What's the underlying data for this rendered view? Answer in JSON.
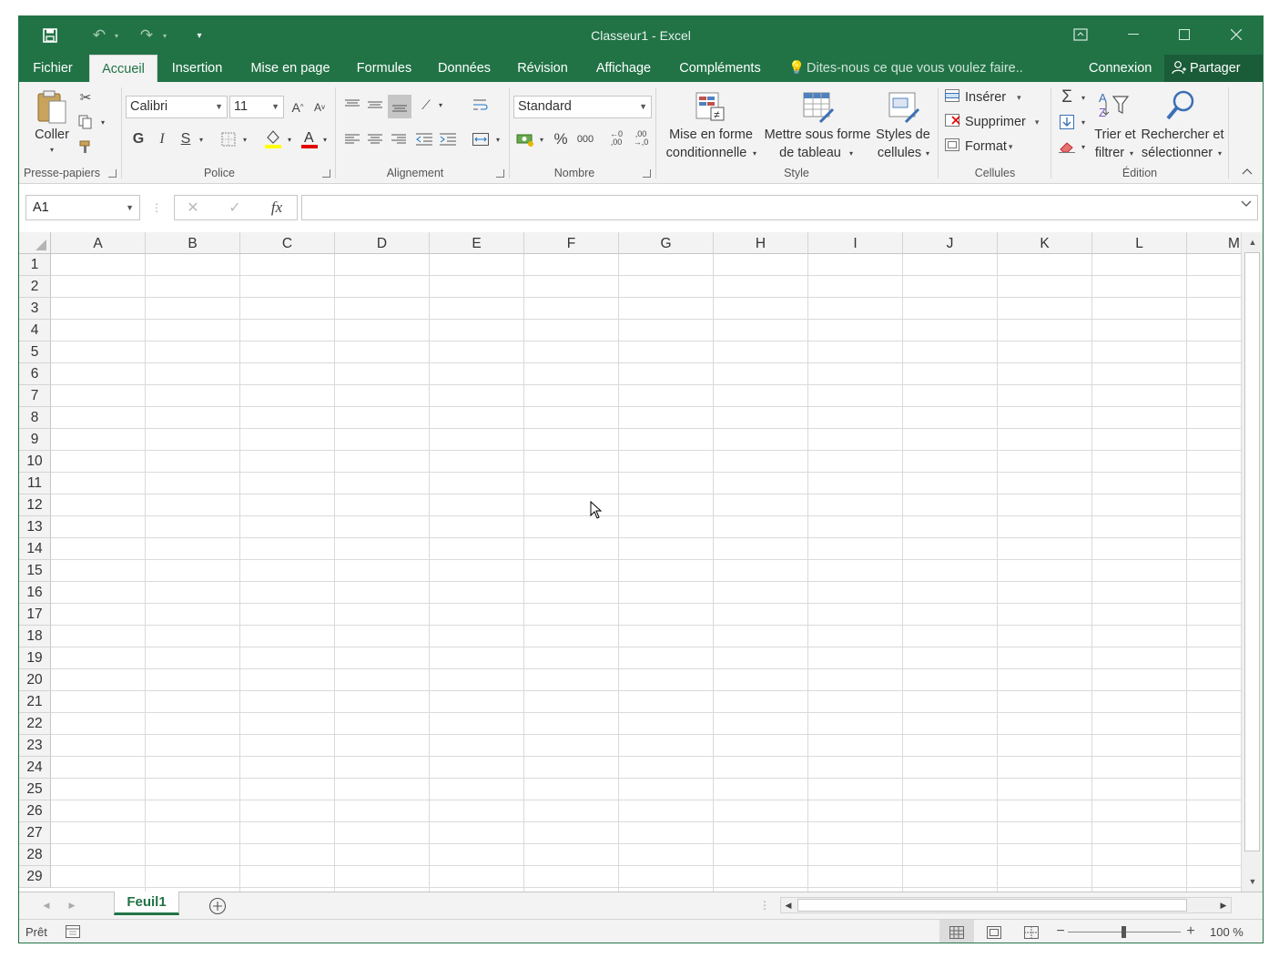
{
  "window": {
    "title": "Classeur1 - Excel",
    "accent": "#217346"
  },
  "qat": {
    "save_icon": "save-icon",
    "undo_icon": "undo-icon",
    "redo_icon": "redo-icon",
    "customize_icon": "customize-qat-icon"
  },
  "tabs": [
    {
      "label": "Fichier"
    },
    {
      "label": "Accueil"
    },
    {
      "label": "Insertion"
    },
    {
      "label": "Mise en page"
    },
    {
      "label": "Formules"
    },
    {
      "label": "Données"
    },
    {
      "label": "Révision"
    },
    {
      "label": "Affichage"
    },
    {
      "label": "Compléments"
    }
  ],
  "tell_me": "Dites-nous ce que vous voulez faire..",
  "signin": "Connexion",
  "share": "Partager",
  "ribbon": {
    "clipboard": {
      "label": "Presse-papiers",
      "paste": "Coller"
    },
    "font": {
      "label": "Police",
      "font_name": "Calibri",
      "font_size": "11",
      "bold": "G",
      "italic": "I",
      "underline": "S"
    },
    "alignment": {
      "label": "Alignement"
    },
    "number": {
      "label": "Nombre",
      "format": "Standard",
      "percent": "%",
      "thousands": "000"
    },
    "style": {
      "label": "Style",
      "conditional_line1": "Mise en forme",
      "conditional_line2": "conditionnelle",
      "table_line1": "Mettre sous forme",
      "table_line2": "de tableau",
      "cellstyles_line1": "Styles de",
      "cellstyles_line2": "cellules"
    },
    "cells": {
      "label": "Cellules",
      "insert": "Insérer",
      "delete": "Supprimer",
      "format": "Format"
    },
    "editing": {
      "label": "Édition",
      "sort_line1": "Trier et",
      "sort_line2": "filtrer",
      "find_line1": "Rechercher et",
      "find_line2": "sélectionner"
    }
  },
  "formula_bar": {
    "name_box": "A1",
    "fx": "fx",
    "formula": ""
  },
  "columns": [
    "A",
    "B",
    "C",
    "D",
    "E",
    "F",
    "G",
    "H",
    "I",
    "J",
    "K",
    "L",
    "M"
  ],
  "rows": [
    "1",
    "2",
    "3",
    "4",
    "5",
    "6",
    "7",
    "8",
    "9",
    "10",
    "11",
    "12",
    "13",
    "14",
    "15",
    "16",
    "17",
    "18",
    "19",
    "20",
    "21",
    "22",
    "23",
    "24",
    "25",
    "26",
    "27",
    "28",
    "29"
  ],
  "sheets": {
    "active": "Feuil1"
  },
  "status": {
    "mode": "Prêt",
    "zoom": "100 %"
  }
}
